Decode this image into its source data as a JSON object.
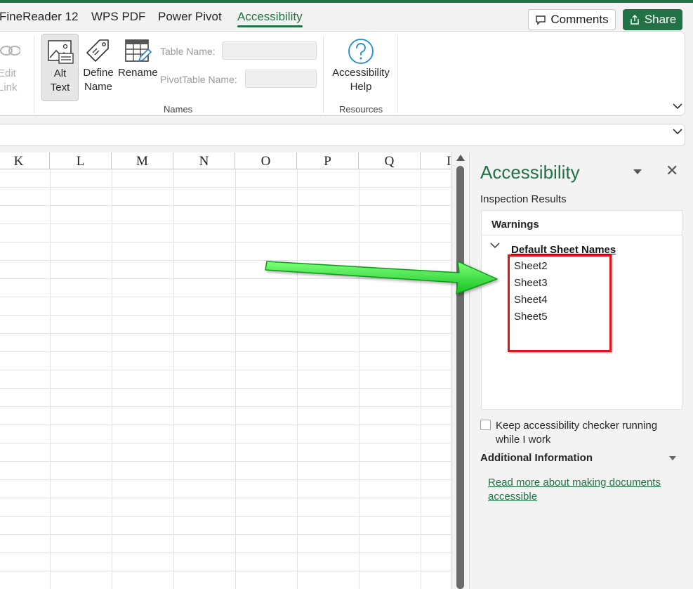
{
  "tabs": [
    {
      "label": "FineReader 12"
    },
    {
      "label": "WPS PDF"
    },
    {
      "label": "Power Pivot"
    },
    {
      "label": "Accessibility",
      "active": true
    }
  ],
  "header": {
    "comments_label": "Comments",
    "share_label": "Share"
  },
  "ribbon": {
    "edit_link": "Edit Link",
    "alt_text": {
      "line1": "Alt",
      "line2": "Text"
    },
    "define_name": {
      "line1": "Define",
      "line2": "Name"
    },
    "rename": "Rename",
    "table_name_label": "Table Name:",
    "pivot_table_name_label": "PivotTable Name:",
    "names_group": "Names",
    "accessibility_help": {
      "line1": "Accessibility",
      "line2": "Help"
    },
    "resources_group": "Resources"
  },
  "grid": {
    "columns": [
      "K",
      "L",
      "M",
      "N",
      "O",
      "P",
      "Q",
      "I"
    ]
  },
  "pane": {
    "title": "Accessibility",
    "inspection_label": "Inspection Results",
    "warnings_heading": "Warnings",
    "category_title": "Default Sheet Names",
    "items": [
      "Sheet2",
      "Sheet3",
      "Sheet4",
      "Sheet5"
    ],
    "keep_running_label": "Keep accessibility checker running while I work",
    "keep_running_checked": false,
    "additional_info": "Additional Information",
    "read_more_link": "Read more about making documents accessible"
  },
  "colors": {
    "accent": "#217346",
    "annotation_box": "#e0161e",
    "annotation_arrow": "#2ee83a"
  }
}
